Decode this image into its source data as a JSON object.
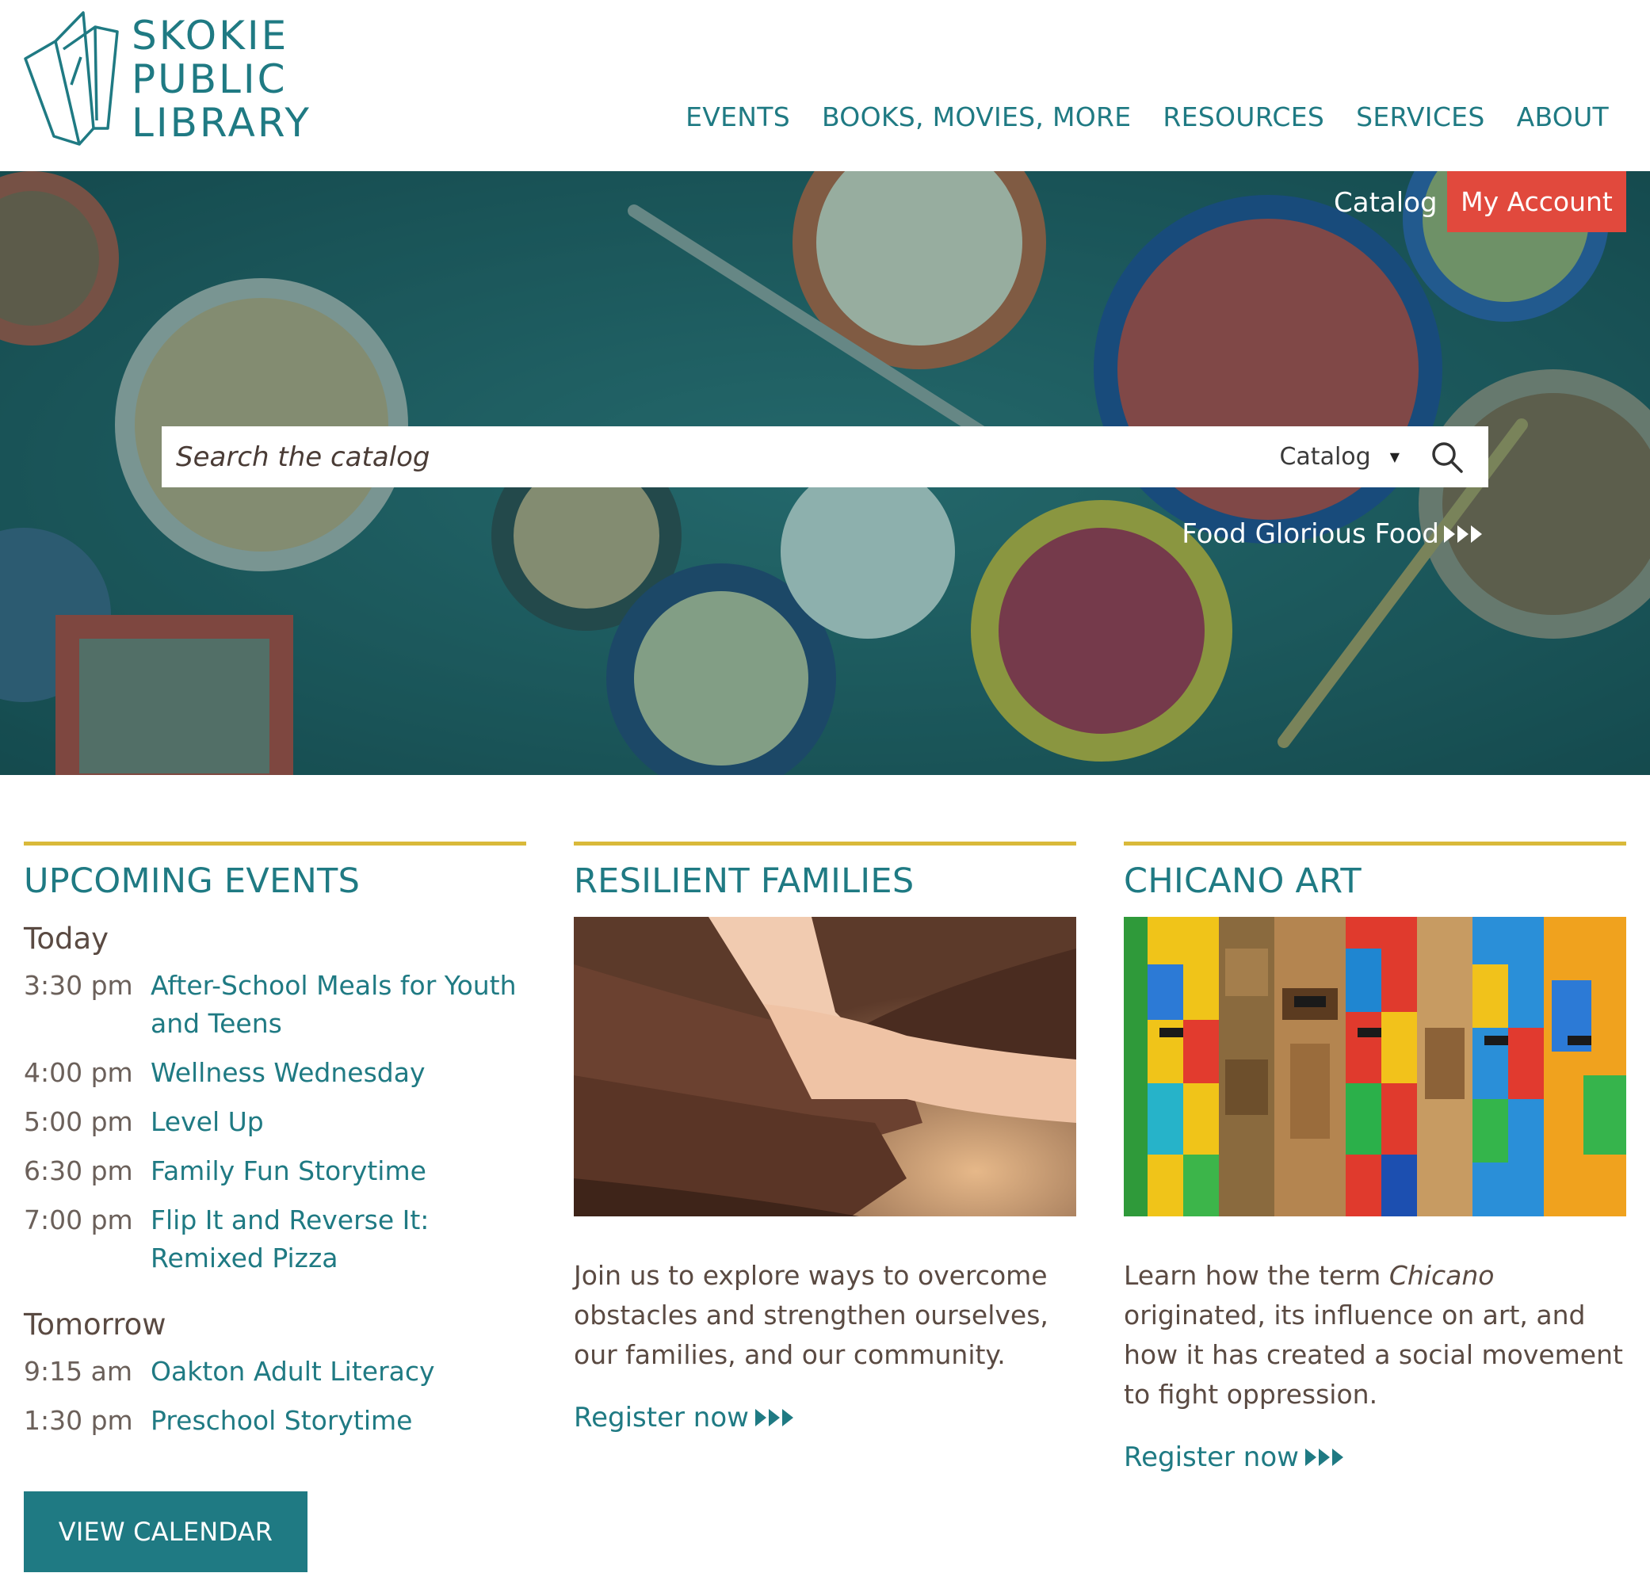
{
  "colors": {
    "teal": "#1f7a83",
    "red": "#e1493d",
    "gold": "#d9b93a",
    "brown_text": "#5a4a42"
  },
  "logo": {
    "line1": "SKOKIE",
    "line2": "PUBLIC",
    "line3": "LIBRARY",
    "icon": "library-books-logo-icon"
  },
  "nav": {
    "items": [
      {
        "label": "EVENTS"
      },
      {
        "label": "BOOKS, MOVIES, MORE"
      },
      {
        "label": "RESOURCES"
      },
      {
        "label": "SERVICES"
      },
      {
        "label": "ABOUT"
      }
    ]
  },
  "hero": {
    "catalog_link": "Catalog",
    "account_button": "My Account",
    "search": {
      "placeholder": "Search the catalog",
      "scope": "Catalog",
      "scope_icon": "caret-down-icon",
      "button_icon": "search-icon"
    },
    "promo_link": "Food Glorious Food"
  },
  "events": {
    "title": "UPCOMING EVENTS",
    "days": [
      {
        "label": "Today",
        "items": [
          {
            "time": "3:30 pm",
            "title": "After-School Meals for Youth and Teens"
          },
          {
            "time": "4:00 pm",
            "title": "Wellness Wednesday"
          },
          {
            "time": "5:00 pm",
            "title": "Level Up"
          },
          {
            "time": "6:30 pm",
            "title": "Family Fun Storytime"
          },
          {
            "time": "7:00 pm",
            "title": "Flip It and Reverse It: Remixed Pizza"
          }
        ]
      },
      {
        "label": "Tomorrow",
        "items": [
          {
            "time": "9:15 am",
            "title": "Oakton Adult Literacy"
          },
          {
            "time": "1:30 pm",
            "title": "Preschool Storytime"
          }
        ]
      }
    ],
    "button": "VIEW CALENDAR"
  },
  "features": [
    {
      "title": "RESILIENT FAMILIES",
      "desc": "Join us to explore ways to overcome obstacles and strengthen ourselves, our families, and our community.",
      "link": "Register now"
    },
    {
      "title": "CHICANO ART",
      "desc_pre": "Learn how the term ",
      "desc_em": "Chicano",
      "desc_post": " originated, its influence on art, and how it has created a social movement to fight oppression.",
      "link": "Register now"
    }
  ]
}
